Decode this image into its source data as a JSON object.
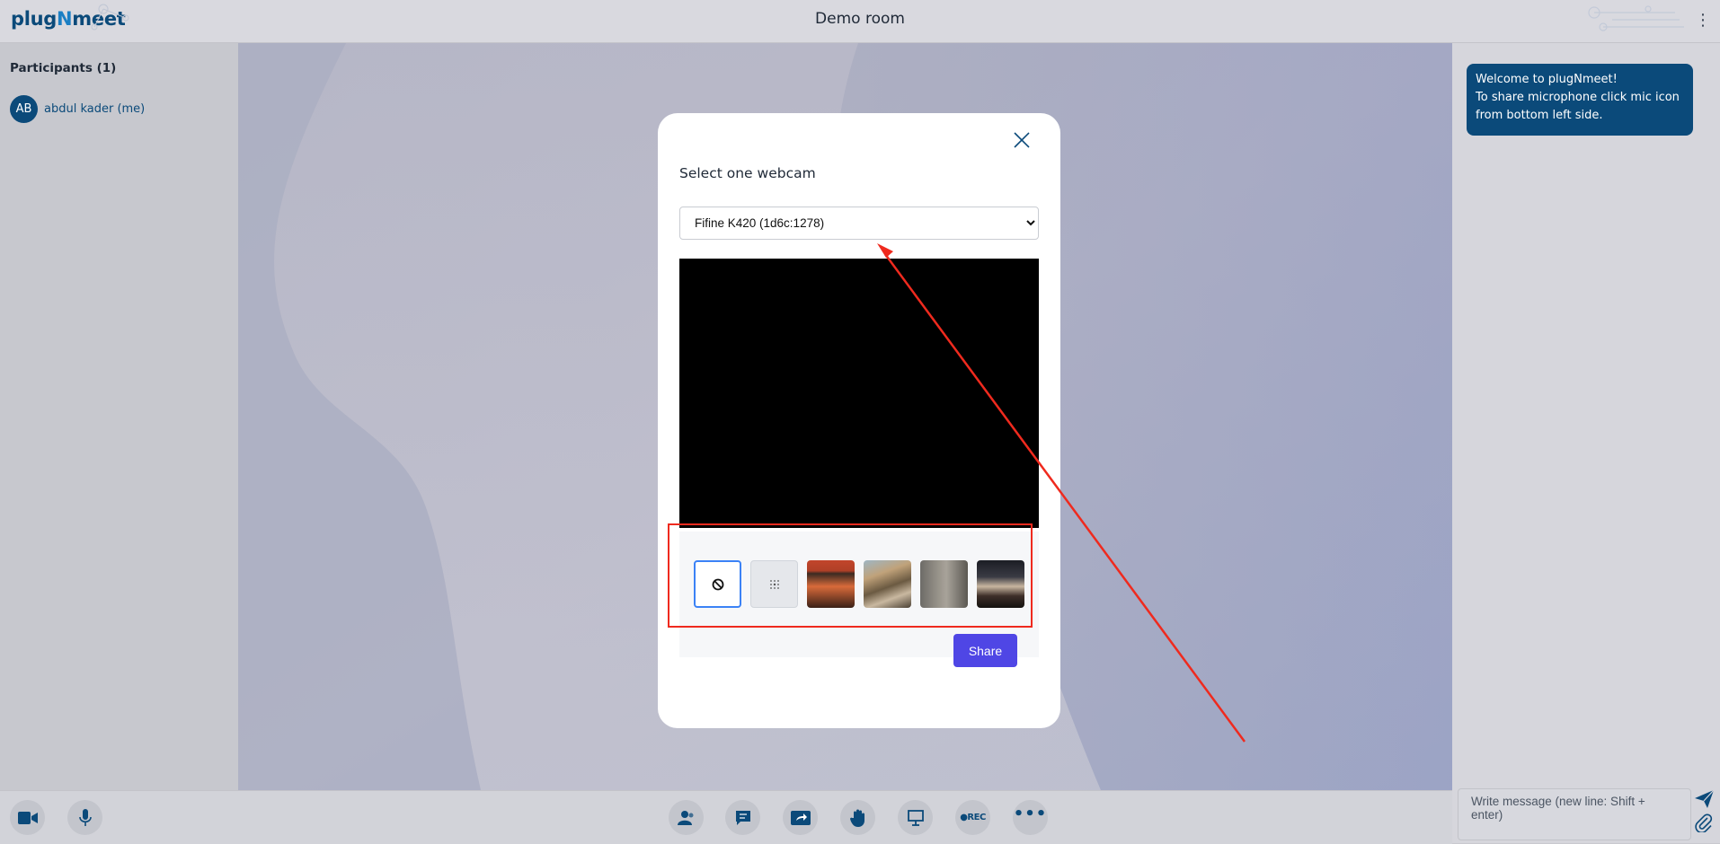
{
  "header": {
    "logo_part1": "plug",
    "logo_part2": "N",
    "logo_part3": "meet",
    "room_title": "Demo room",
    "menu_icon": "kebab-menu-icon"
  },
  "sidebar": {
    "title": "Participants (1)",
    "participants": [
      {
        "initials": "AB",
        "name": "abdul kader (me)"
      }
    ]
  },
  "chat": {
    "welcome_lines": [
      "Welcome to plugNmeet!",
      "To share microphone click mic icon",
      "from bottom left side."
    ],
    "input_placeholder": "Write message (new line: Shift + enter)",
    "send_icon": "send-icon",
    "attach_icon": "paperclip-icon"
  },
  "modal": {
    "title": "Select one webcam",
    "selected_device": "Fifine K420 (1d6c:1278)",
    "background_options": [
      "none",
      "blur",
      "image-1",
      "image-2",
      "image-3",
      "image-4"
    ],
    "selected_background": "none",
    "share_label": "Share"
  },
  "toolbar": {
    "left": [
      "webcam-icon",
      "microphone-icon"
    ],
    "center": [
      "participants-icon",
      "chat-icon",
      "screen-share-icon",
      "raise-hand-icon",
      "whiteboard-icon",
      "record-icon",
      "more-options-icon"
    ],
    "rec_label": "●REC",
    "more_label": "•••"
  },
  "colors": {
    "brand": "#0b4a7a",
    "accent": "#4f46e5",
    "annotation": "#ef2a1e"
  }
}
